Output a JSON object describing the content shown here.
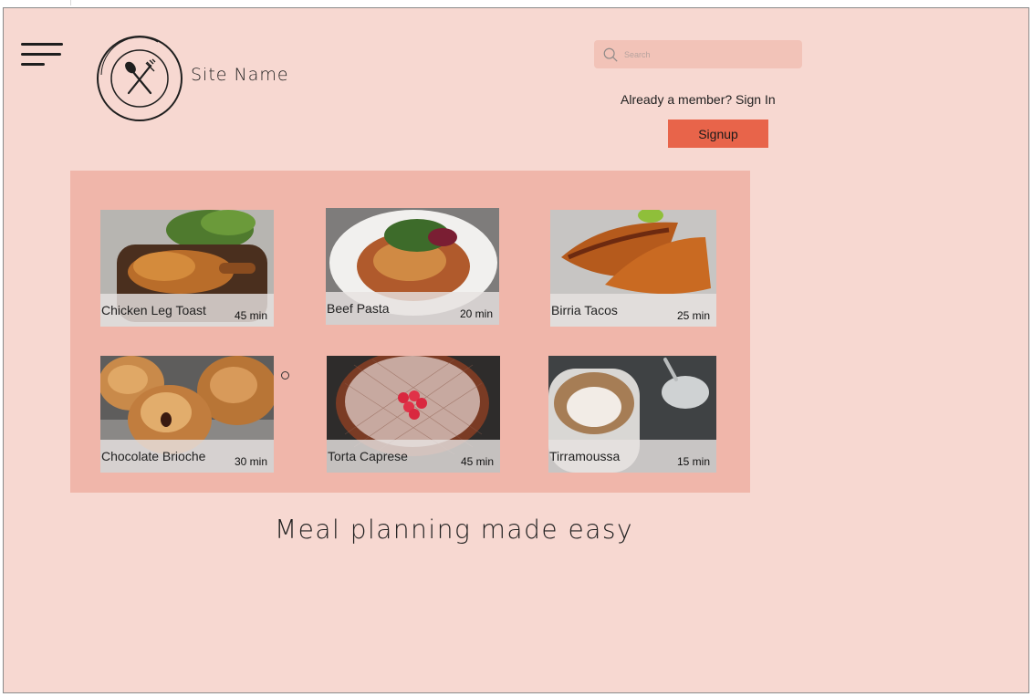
{
  "header": {
    "site_name": "Site Name",
    "search_placeholder": "Search",
    "signin_text": "Already a member? Sign In",
    "signup_label": "Signup"
  },
  "recipes": [
    {
      "name": "Chicken Leg Toast",
      "time": "45 min",
      "icon": "chicken-toast-photo"
    },
    {
      "name": "Beef Pasta",
      "time": "20 min",
      "icon": "beef-pasta-photo"
    },
    {
      "name": "Birria Tacos",
      "time": "25  min",
      "icon": "birria-tacos-photo"
    },
    {
      "name": "Chocolate Brioche",
      "time": "30 min",
      "icon": "brioche-photo"
    },
    {
      "name": "Torta Caprese",
      "time": "45 min",
      "icon": "torta-caprese-photo"
    },
    {
      "name": "Tirramoussa",
      "time": "15 min",
      "icon": "tirramoussa-photo"
    }
  ],
  "tagline": "Meal planning made easy",
  "colors": {
    "background": "#f7d8d1",
    "panel": "#f0b6aa",
    "search_bg": "#f2c3b8",
    "accent": "#e8644a"
  }
}
